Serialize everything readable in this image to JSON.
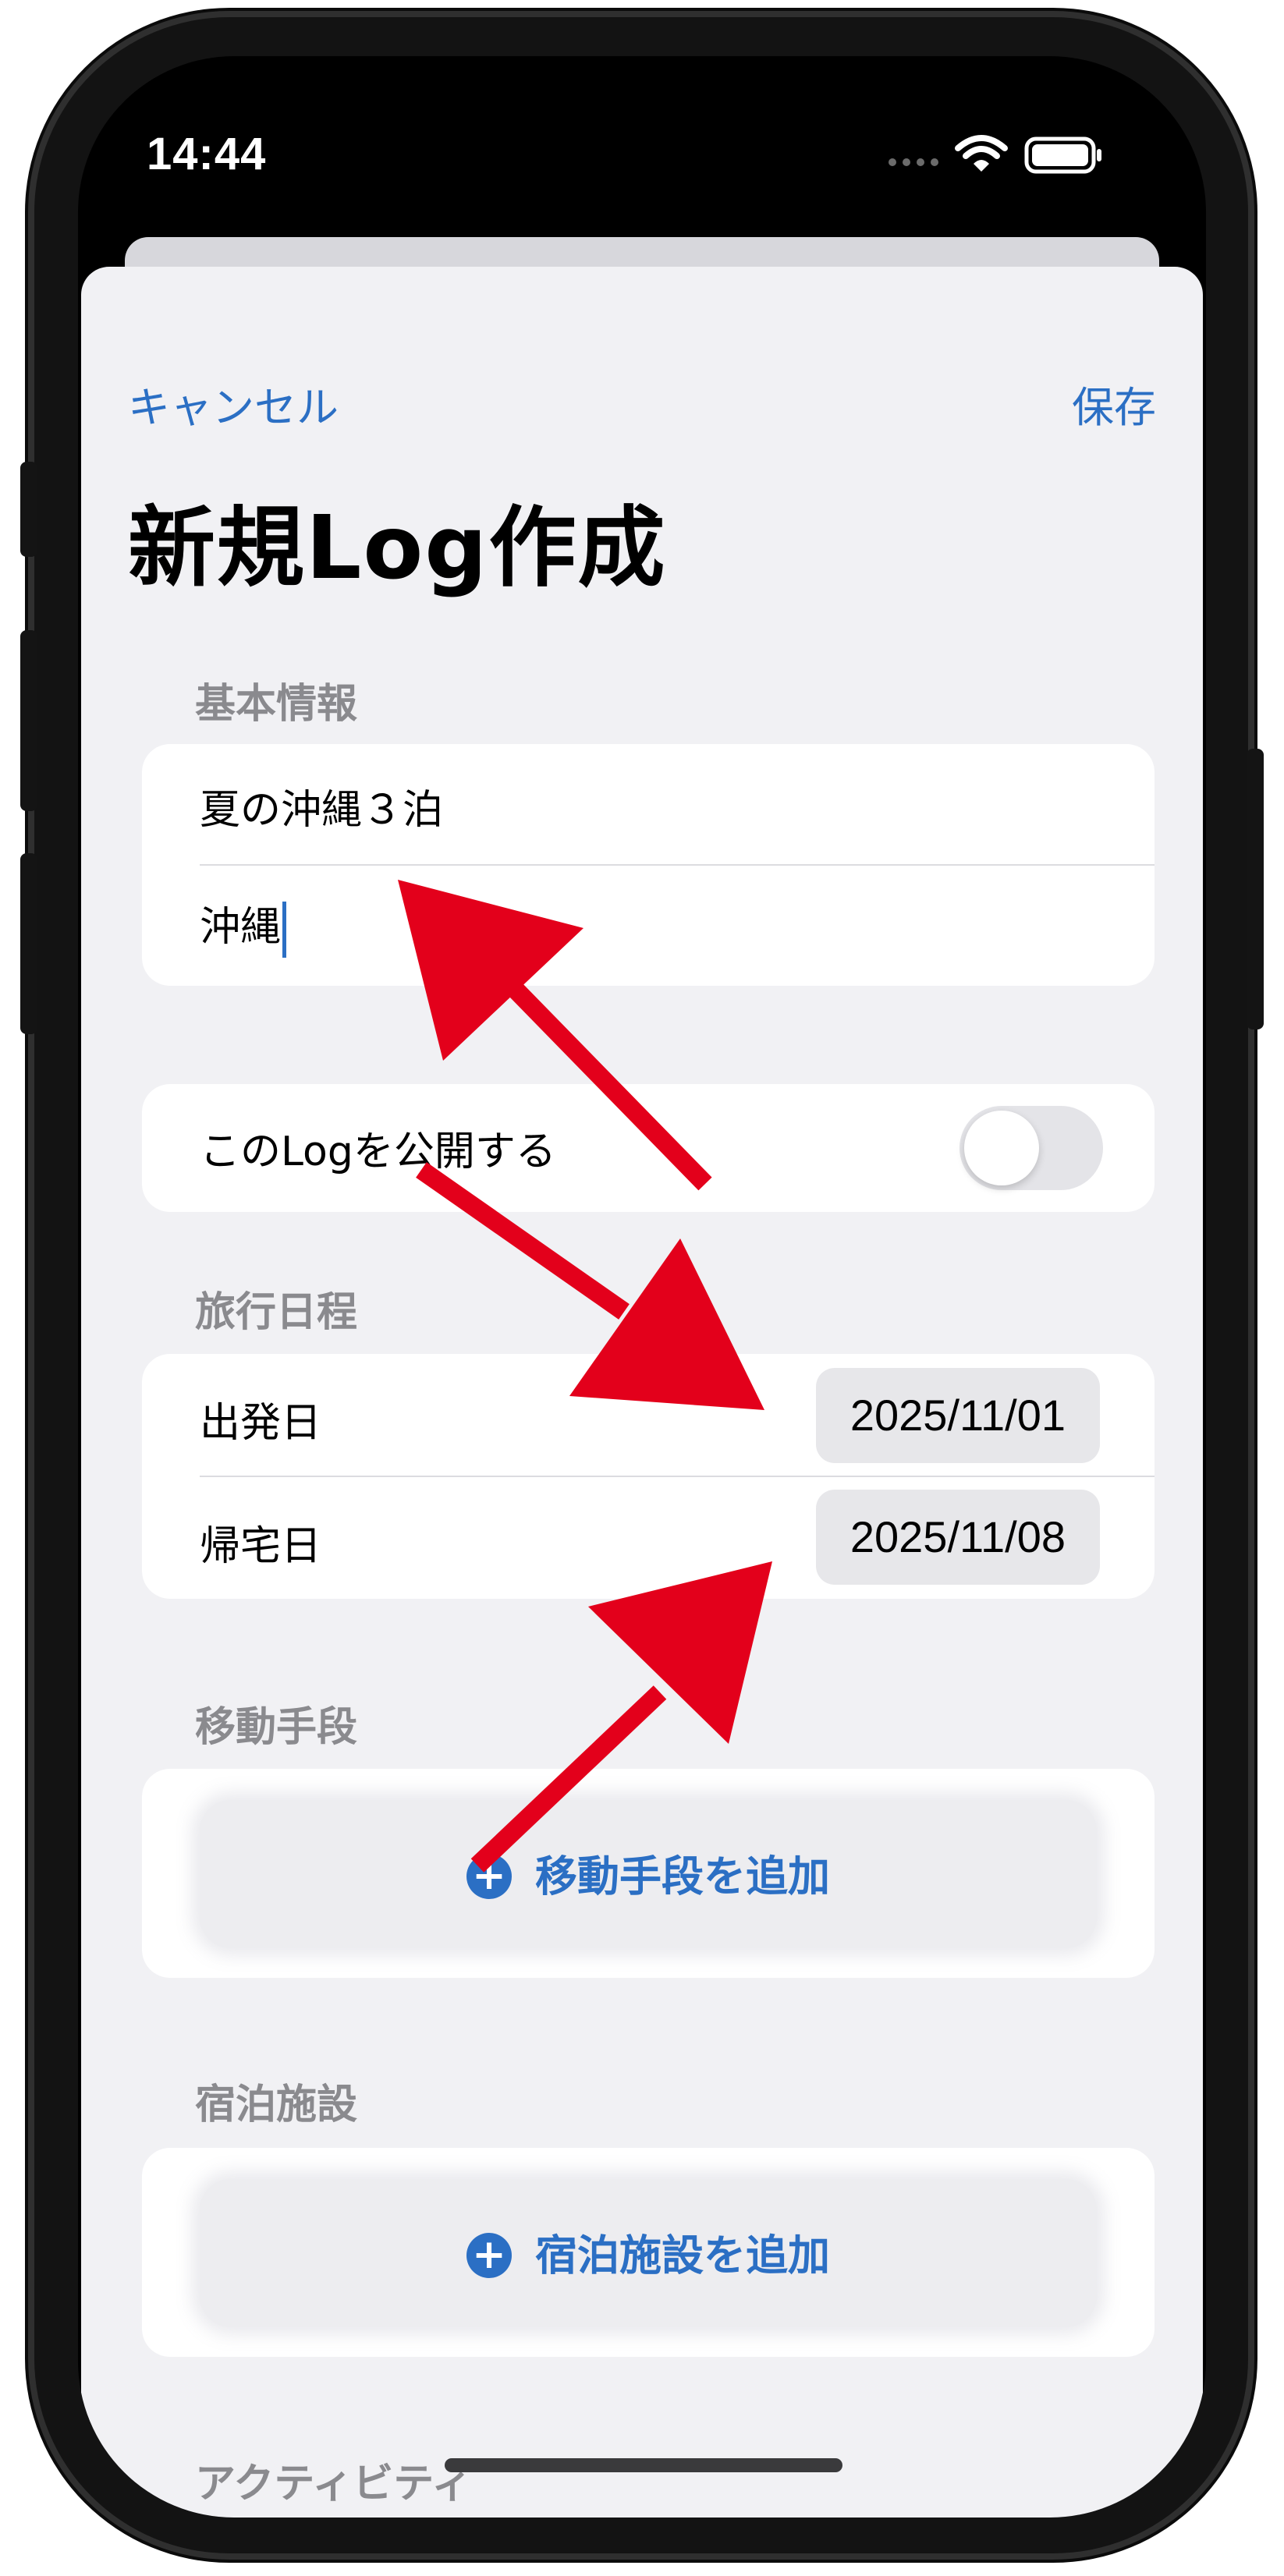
{
  "status_bar": {
    "time": "14:44",
    "signal_icon": "signal-dots-icon",
    "wifi_icon": "wifi-icon",
    "battery_icon": "battery-icon"
  },
  "nav": {
    "cancel_label": "キャンセル",
    "save_label": "保存",
    "title": "新規Log作成"
  },
  "basic_info": {
    "header": "基本情報",
    "title_value": "夏の沖縄３泊",
    "destination_value": "沖縄"
  },
  "publish": {
    "label": "このLogを公開する",
    "enabled": false
  },
  "schedule": {
    "header": "旅行日程",
    "departure_label": "出発日",
    "departure_value": "2025/11/01",
    "return_label": "帰宅日",
    "return_value": "2025/11/08"
  },
  "transport": {
    "header": "移動手段",
    "add_label": "移動手段を追加"
  },
  "lodging": {
    "header": "宿泊施設",
    "add_label": "宿泊施設を追加"
  },
  "activity": {
    "header": "アクティビティ"
  },
  "colors": {
    "accent": "#2b6fc4",
    "annotation_arrow": "#e3001b",
    "sheet_background": "#f1f1f4"
  }
}
